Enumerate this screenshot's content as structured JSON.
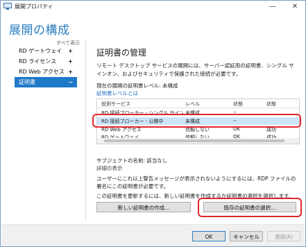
{
  "window": {
    "title": "展開プロパティ",
    "controls": {
      "minimize": "—",
      "close": "✕"
    }
  },
  "header": {
    "title": "展開の構成"
  },
  "sidebar": {
    "show_all": "すべて表示",
    "items": [
      {
        "label": "RD ゲートウェイ",
        "symbol": "+"
      },
      {
        "label": "RD ライセンス",
        "symbol": "+"
      },
      {
        "label": "RD Web アクセス",
        "symbol": "+"
      },
      {
        "label": "証明書",
        "symbol": "−"
      }
    ]
  },
  "main": {
    "section_title": "証明書の管理",
    "description": "リモート デスクトップ サービスの展開には、サーバー認証用の証明書、シングル サインオン、およびセキュリティで保護された接続が必要です。",
    "level_line": "現在の展開の証明書レベル: 未構成",
    "level_link": "証明書レベルとは",
    "table": {
      "headers": [
        "役割サービス",
        "レベル",
        "状態",
        "状態"
      ],
      "rows": [
        [
          "RD 接続ブローカー - シングル サインオンを有効にする",
          "未構成",
          "--",
          ""
        ],
        [
          "RD 接続ブローカー - 公開中",
          "未構成",
          "--",
          ""
        ],
        [
          "RD Web アクセス",
          "信頼しない",
          "OK",
          "成功"
        ],
        [
          "RD ゲートウェイ",
          "信頼しない",
          "OK",
          "成功"
        ]
      ],
      "selected_row": 1
    },
    "subject_line": "サブジェクトの名前: 該当なし",
    "detail_link": "詳細の表示",
    "warning": "ユーザーにこれ以上警告メッセージが表示されないようにするには、RDP ファイルの署名にこの証明書が必要です。",
    "renew_text": "この証明書を更新するには、新しい証明書を作成するか証明書の選択を選択します。",
    "buttons": {
      "new_cert": "新しい証明書の作成...",
      "select_cert": "既存の証明書の選択..."
    }
  },
  "footer": {
    "ok": "OK",
    "cancel": "キャンセル",
    "apply": "適用(A)"
  },
  "colors": {
    "accent": "#2a7ec0",
    "selection": "#1f79c9",
    "highlight_frame": "#e0262c"
  }
}
